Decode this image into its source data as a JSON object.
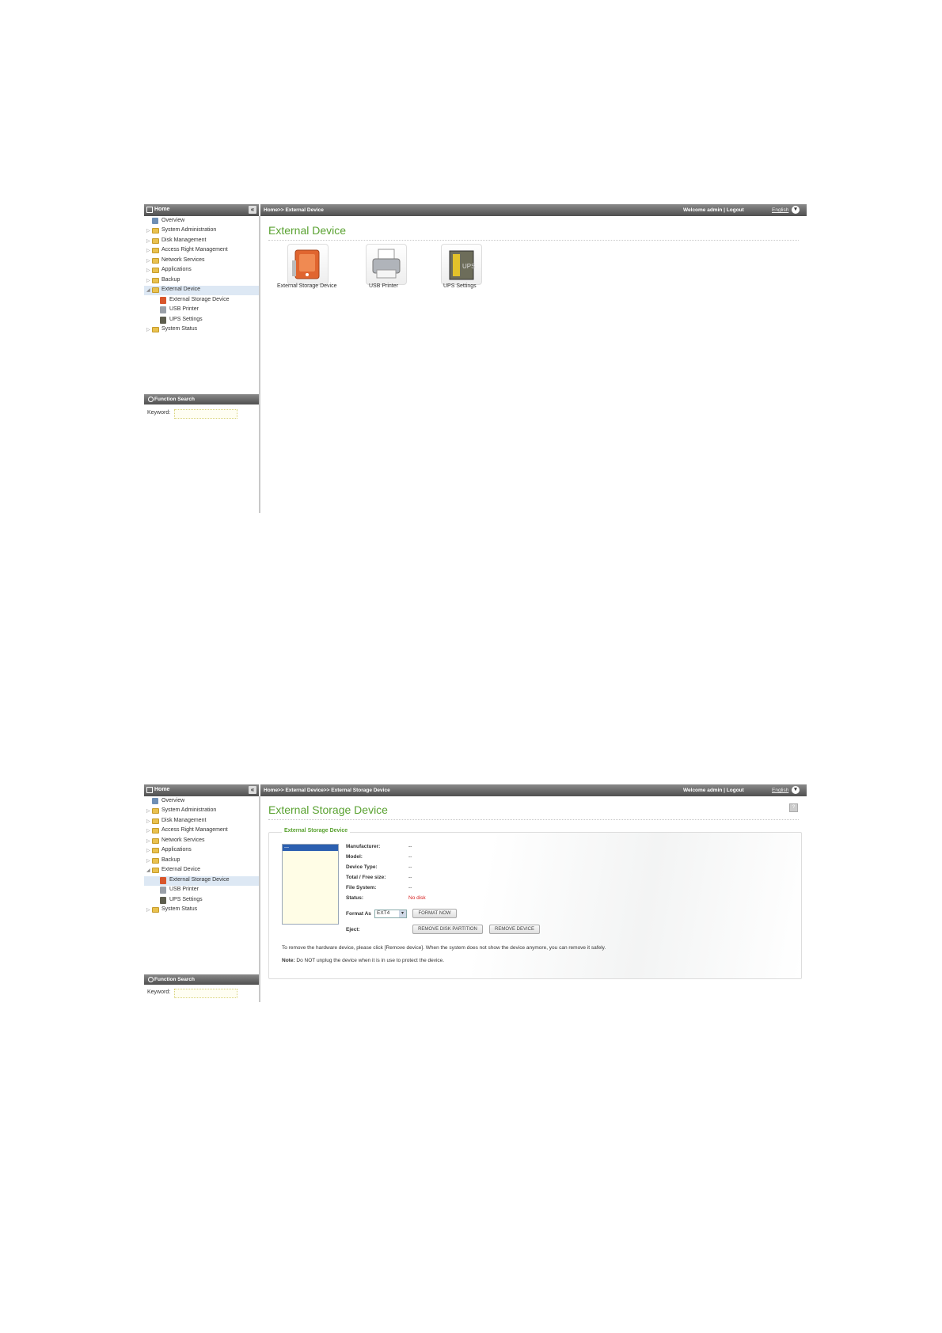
{
  "screen1": {
    "header": {
      "home": "Home",
      "breadcrumb": "Home>> External Device",
      "welcome": "Welcome admin | Logout",
      "language": "English"
    },
    "sidebar": {
      "items": [
        {
          "label": "Overview"
        },
        {
          "label": "System Administration"
        },
        {
          "label": "Disk Management"
        },
        {
          "label": "Access Right Management"
        },
        {
          "label": "Network Services"
        },
        {
          "label": "Applications"
        },
        {
          "label": "Backup"
        },
        {
          "label": "External Device"
        },
        {
          "label": "External Storage Device"
        },
        {
          "label": "USB Printer"
        },
        {
          "label": "UPS Settings"
        },
        {
          "label": "System Status"
        }
      ]
    },
    "search": {
      "title": "Function Search",
      "keyword_label": "Keyword:"
    },
    "main": {
      "title": "External Device",
      "devices": [
        {
          "label": "External Storage Device",
          "icon": "external-storage-icon"
        },
        {
          "label": "USB Printer",
          "icon": "printer-icon"
        },
        {
          "label": "UPS Settings",
          "icon": "ups-icon"
        }
      ]
    }
  },
  "screen2": {
    "header": {
      "home": "Home",
      "breadcrumb": "Home>> External Device>> External Storage Device",
      "welcome": "Welcome admin | Logout",
      "language": "English"
    },
    "search": {
      "title": "Function Search",
      "keyword_label": "Keyword:"
    },
    "main": {
      "title": "External Storage Device",
      "legend": "External Storage Device",
      "list_item": "---",
      "fields": {
        "manufacturer_label": "Manufacturer:",
        "manufacturer_value": "--",
        "model_label": "Model:",
        "model_value": "--",
        "device_type_label": "Device Type:",
        "device_type_value": "--",
        "size_label": "Total / Free size:",
        "size_value": "--",
        "fs_label": "File System:",
        "fs_value": "--",
        "status_label": "Status:",
        "status_value": "No disk"
      },
      "format_label": "Format As",
      "format_value": "EXT4",
      "format_button": "FORMAT NOW",
      "eject_label": "Eject:",
      "remove_partition_button": "REMOVE DISK PARTITION",
      "remove_device_button": "REMOVE DEVICE",
      "instruction": "To remove the hardware device, please click [Remove device]. When the system does not show the device anymore, you can remove it safely.",
      "note_label": "Note:",
      "note_text": " Do NOT unplug the device when it is in use to protect the device."
    }
  },
  "colors": {
    "accent": "#5aa231",
    "header": "#5a5a5a",
    "selection": "#dde8f4",
    "error": "#d62020"
  }
}
